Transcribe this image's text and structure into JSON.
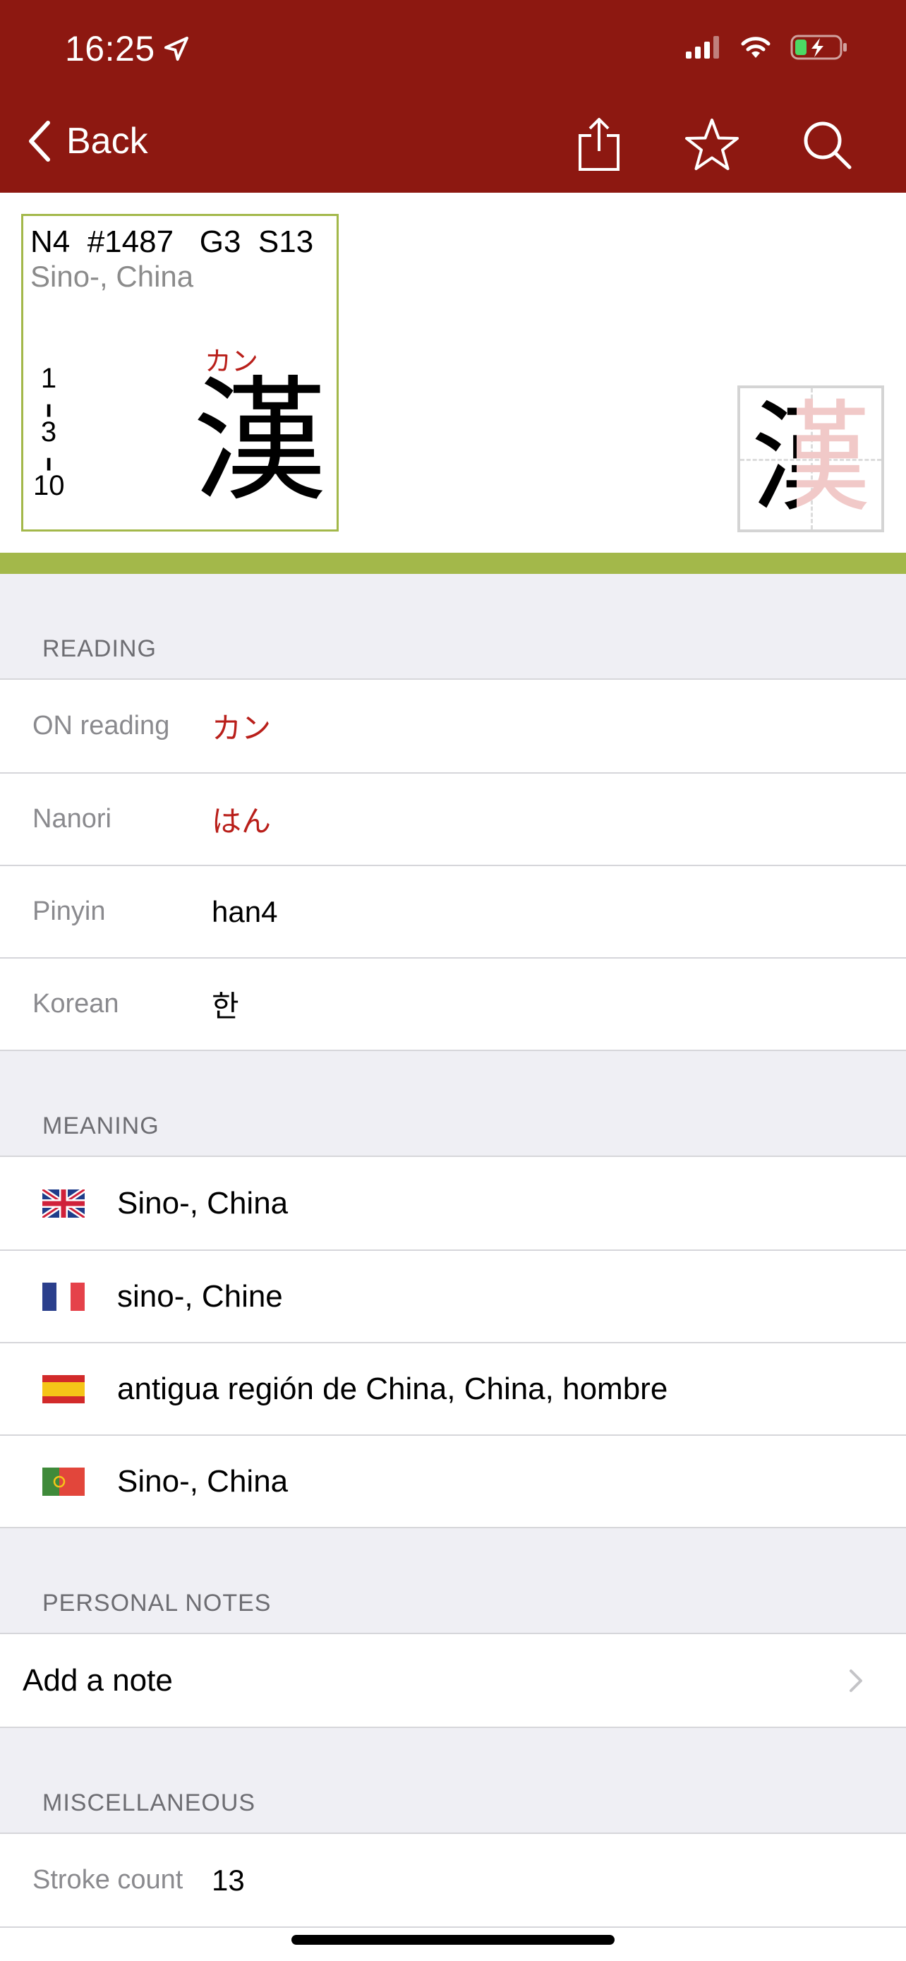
{
  "status_bar": {
    "time": "16:25",
    "location_icon": "location-arrow-icon",
    "signal_icon": "cellular-signal-icon",
    "wifi_icon": "wifi-icon",
    "battery_icon": "battery-charging-icon"
  },
  "nav": {
    "back_label": "Back",
    "share_icon": "share-icon",
    "favorite_icon": "star-icon",
    "search_icon": "search-icon"
  },
  "colors": {
    "header": "#8d1811",
    "accent_green": "#a3b84a",
    "reading_red": "#b91f1a"
  },
  "kanji": {
    "level": "N4",
    "index": "#1487",
    "grade": "G3",
    "strokes_label": "S13",
    "short_meaning": "Sino-, China",
    "stroke_order": [
      "1",
      "3",
      "10"
    ],
    "on_kana": "カン",
    "character": "漢"
  },
  "sections": {
    "reading": {
      "title": "READING",
      "rows": [
        {
          "label": "ON reading",
          "value": "カン"
        },
        {
          "label": "Nanori",
          "value": "はん"
        },
        {
          "label": "Pinyin",
          "value": "han4"
        },
        {
          "label": "Korean",
          "value": "한"
        }
      ]
    },
    "meaning": {
      "title": "MEANING",
      "rows": [
        {
          "flag": "uk-flag-icon",
          "text": "Sino-, China"
        },
        {
          "flag": "france-flag-icon",
          "text": "sino-, Chine"
        },
        {
          "flag": "spain-flag-icon",
          "text": "antigua región de China, China, hombre"
        },
        {
          "flag": "portugal-flag-icon",
          "text": "Sino-, China"
        }
      ]
    },
    "notes": {
      "title": "PERSONAL NOTES",
      "add_label": "Add a note"
    },
    "misc": {
      "title": "MISCELLANEOUS",
      "rows": [
        {
          "label": "Stroke count",
          "value": "13"
        }
      ]
    }
  }
}
